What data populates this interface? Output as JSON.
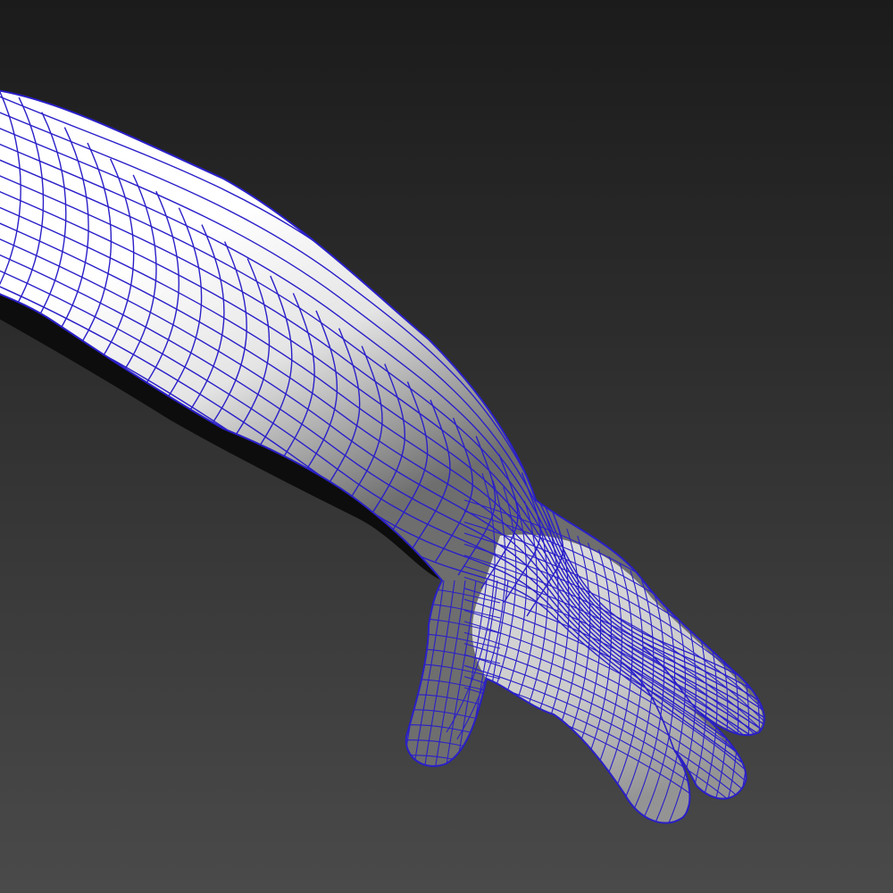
{
  "viewport": {
    "background_top": "#1b1b1b",
    "background_bottom": "#4a4a4a"
  },
  "model": {
    "subject": "arm-with-hand",
    "surface_color": "#e4e4e4",
    "highlight_color": "#ffffff",
    "shadow_color": "#6e6e6e",
    "wireframe_color": "#2a1fc8",
    "wireframe_visible": true
  }
}
